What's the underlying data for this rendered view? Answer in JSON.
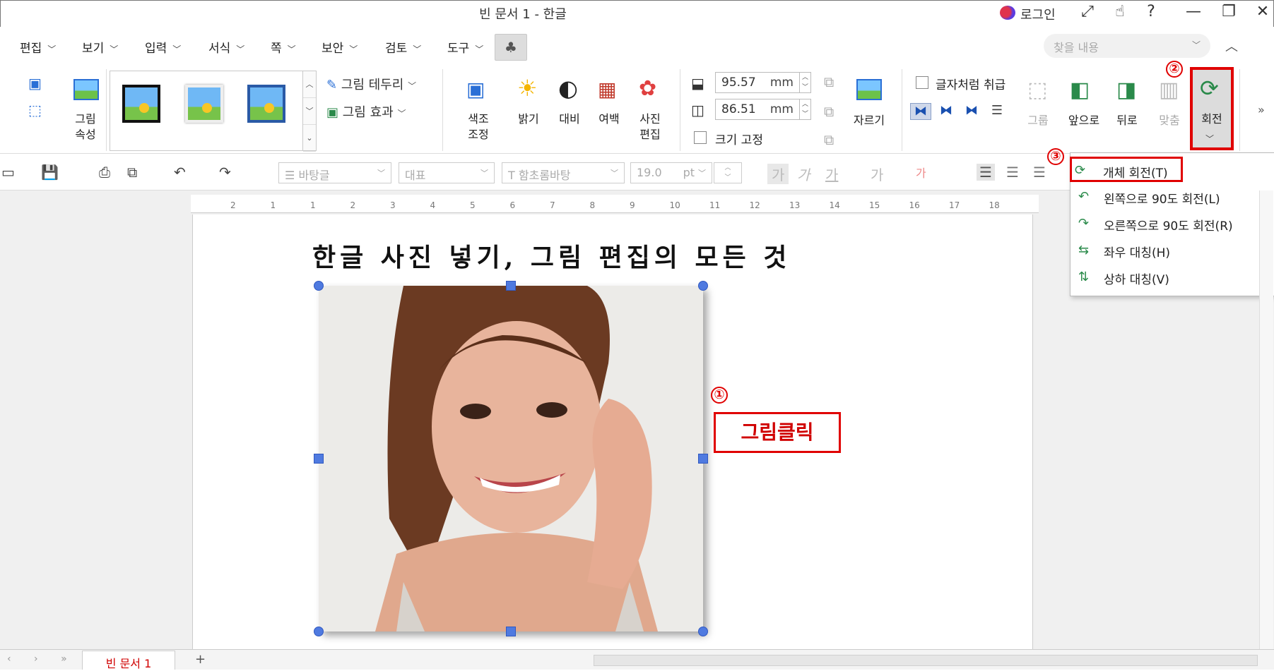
{
  "window": {
    "title": "빈 문서 1 - 한글",
    "login_label": "로그인",
    "buttons": [
      "⤢",
      "☝",
      "?",
      "—",
      "❐",
      "✕"
    ]
  },
  "menu": [
    "편집",
    "보기",
    "입력",
    "서식",
    "쪽",
    "보안",
    "검토",
    "도구"
  ],
  "search": {
    "placeholder": "찾을 내용"
  },
  "ribbon": {
    "picture_props": "그림\n속성",
    "border_label": "그림 테두리",
    "effect_label": "그림 효과",
    "color_adjust": "색조\n조정",
    "brightness": "밝기",
    "contrast": "대비",
    "margin": "여백",
    "photo_edit": "사진\n편집",
    "width_value": "95.57",
    "height_value": "86.51",
    "unit": "mm",
    "fix_size": "크기 고정",
    "crop": "자르기",
    "treat_as_char": "글자처럼 취급",
    "group": "그룹",
    "front": "앞으로",
    "back": "뒤로",
    "align": "맞춤",
    "rotate": "회전"
  },
  "toolbar2": {
    "style": "바탕글",
    "lang": "대표",
    "font": "함초롬바탕",
    "size": "19.0",
    "size_unit": "pt"
  },
  "ruler_ticks": [
    "2",
    "1",
    "1",
    "2",
    "3",
    "4",
    "5",
    "6",
    "7",
    "8",
    "9",
    "10",
    "11",
    "12",
    "13",
    "14",
    "15",
    "16",
    "17",
    "18"
  ],
  "document": {
    "heading": "한글 사진 넣기, 그림 편집의 모든 것",
    "tab_name": "빈 문서 1"
  },
  "rotate_menu": [
    {
      "label": "개체 회전(T)",
      "icon": "⟳"
    },
    {
      "label": "왼쪽으로 90도 회전(L)",
      "icon": "↶"
    },
    {
      "label": "오른쪽으로 90도 회전(R)",
      "icon": "↷"
    },
    {
      "label": "좌우 대칭(H)",
      "icon": "⇆"
    },
    {
      "label": "상하 대칭(V)",
      "icon": "⇅"
    }
  ],
  "annotations": {
    "step1_num": "①",
    "step1_text": "그림클릭",
    "step2_num": "②",
    "step3_num": "③"
  },
  "colors": {
    "accent_red": "#e00000",
    "handle_blue": "#4f7ae0"
  }
}
